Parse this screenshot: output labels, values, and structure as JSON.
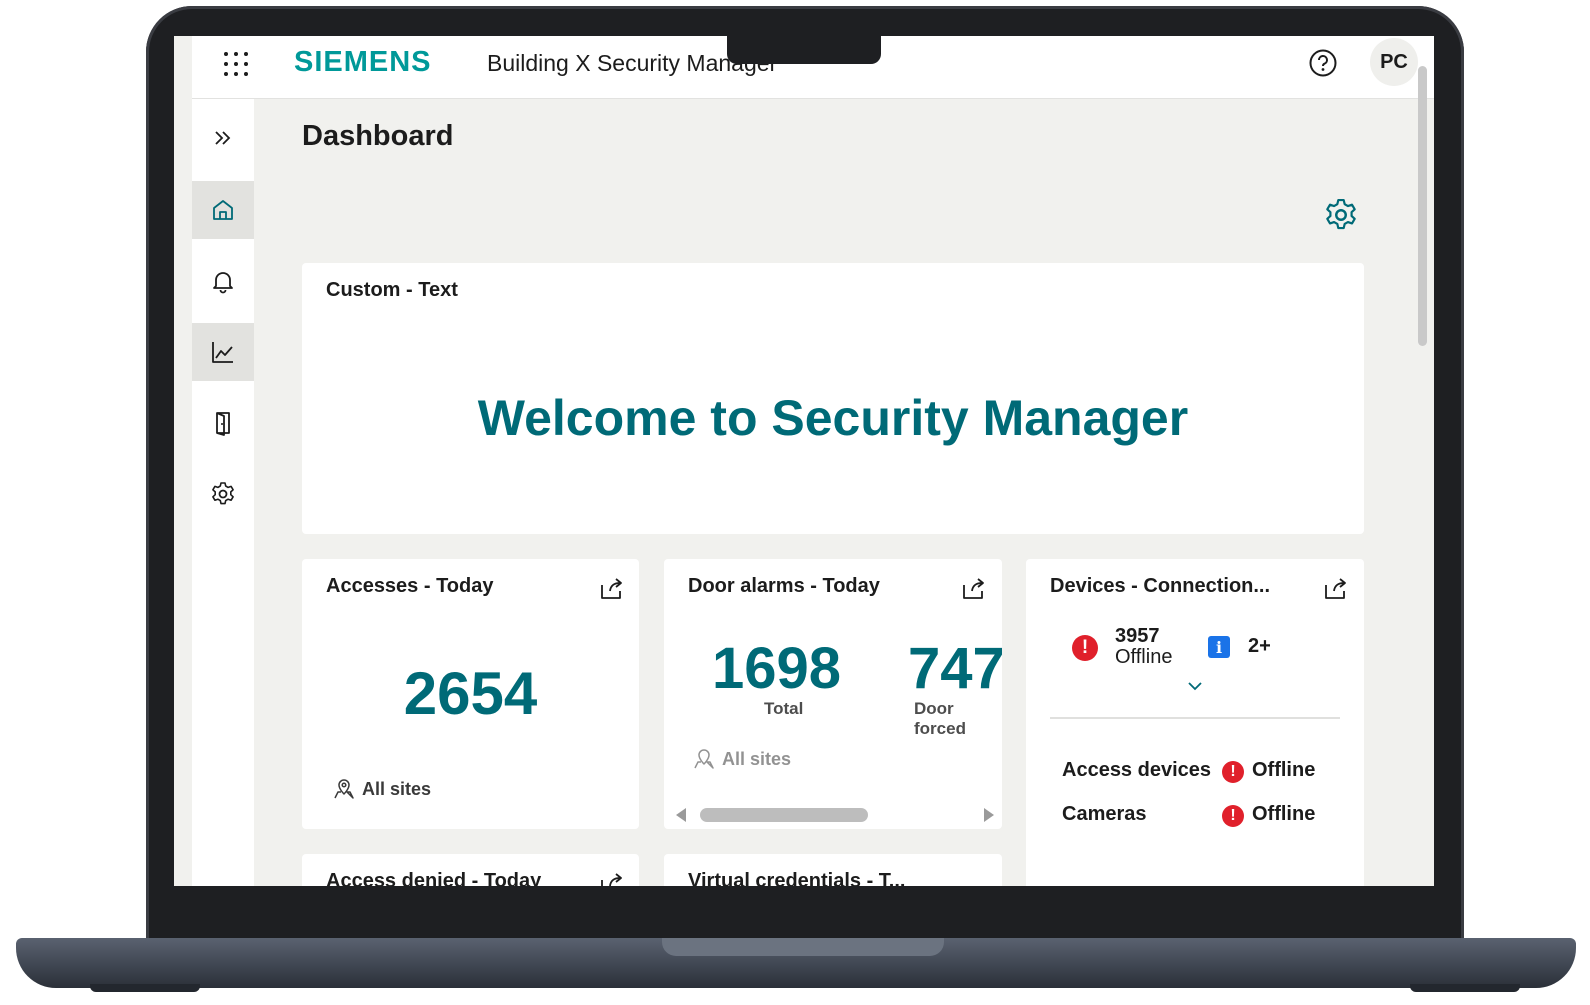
{
  "header": {
    "brand": "SIEMENS",
    "app_title": "Building X Security Manager",
    "avatar_initials": "PC"
  },
  "sidebar": {
    "items": [
      {
        "name": "expand",
        "icon": "double-chevron-right-icon"
      },
      {
        "name": "home",
        "icon": "home-icon",
        "active": true
      },
      {
        "name": "alarms",
        "icon": "bell-icon"
      },
      {
        "name": "reports",
        "icon": "chart-line-icon",
        "active": true
      },
      {
        "name": "doors",
        "icon": "door-icon"
      },
      {
        "name": "settings",
        "icon": "gear-icon"
      }
    ]
  },
  "main": {
    "page_title": "Dashboard",
    "welcome_card": {
      "title": "Custom - Text",
      "text": "Welcome to Security Manager"
    },
    "accesses_card": {
      "title": "Accesses - Today",
      "value": "2654",
      "sites": "All sites"
    },
    "door_alarms_card": {
      "title": "Door alarms - Today",
      "total_value": "1698",
      "total_label": "Total",
      "forced_value": "747",
      "forced_label": "Door forced",
      "sites": "All sites"
    },
    "devices_card": {
      "title": "Devices - Connection...",
      "offline_count": "3957",
      "offline_label": "Offline",
      "info_count": "2+",
      "rows": [
        {
          "label": "Access devices",
          "status": "Offline"
        },
        {
          "label": "Cameras",
          "status": "Offline"
        }
      ]
    },
    "access_denied_card": {
      "title": "Access denied - Today"
    },
    "virtual_credentials_card": {
      "title": "Virtual credentials - T..."
    }
  },
  "colors": {
    "brand": "#009999",
    "accent": "#006a77",
    "error": "#e0202b",
    "info": "#1a73e8",
    "background": "#f1f1ee"
  }
}
